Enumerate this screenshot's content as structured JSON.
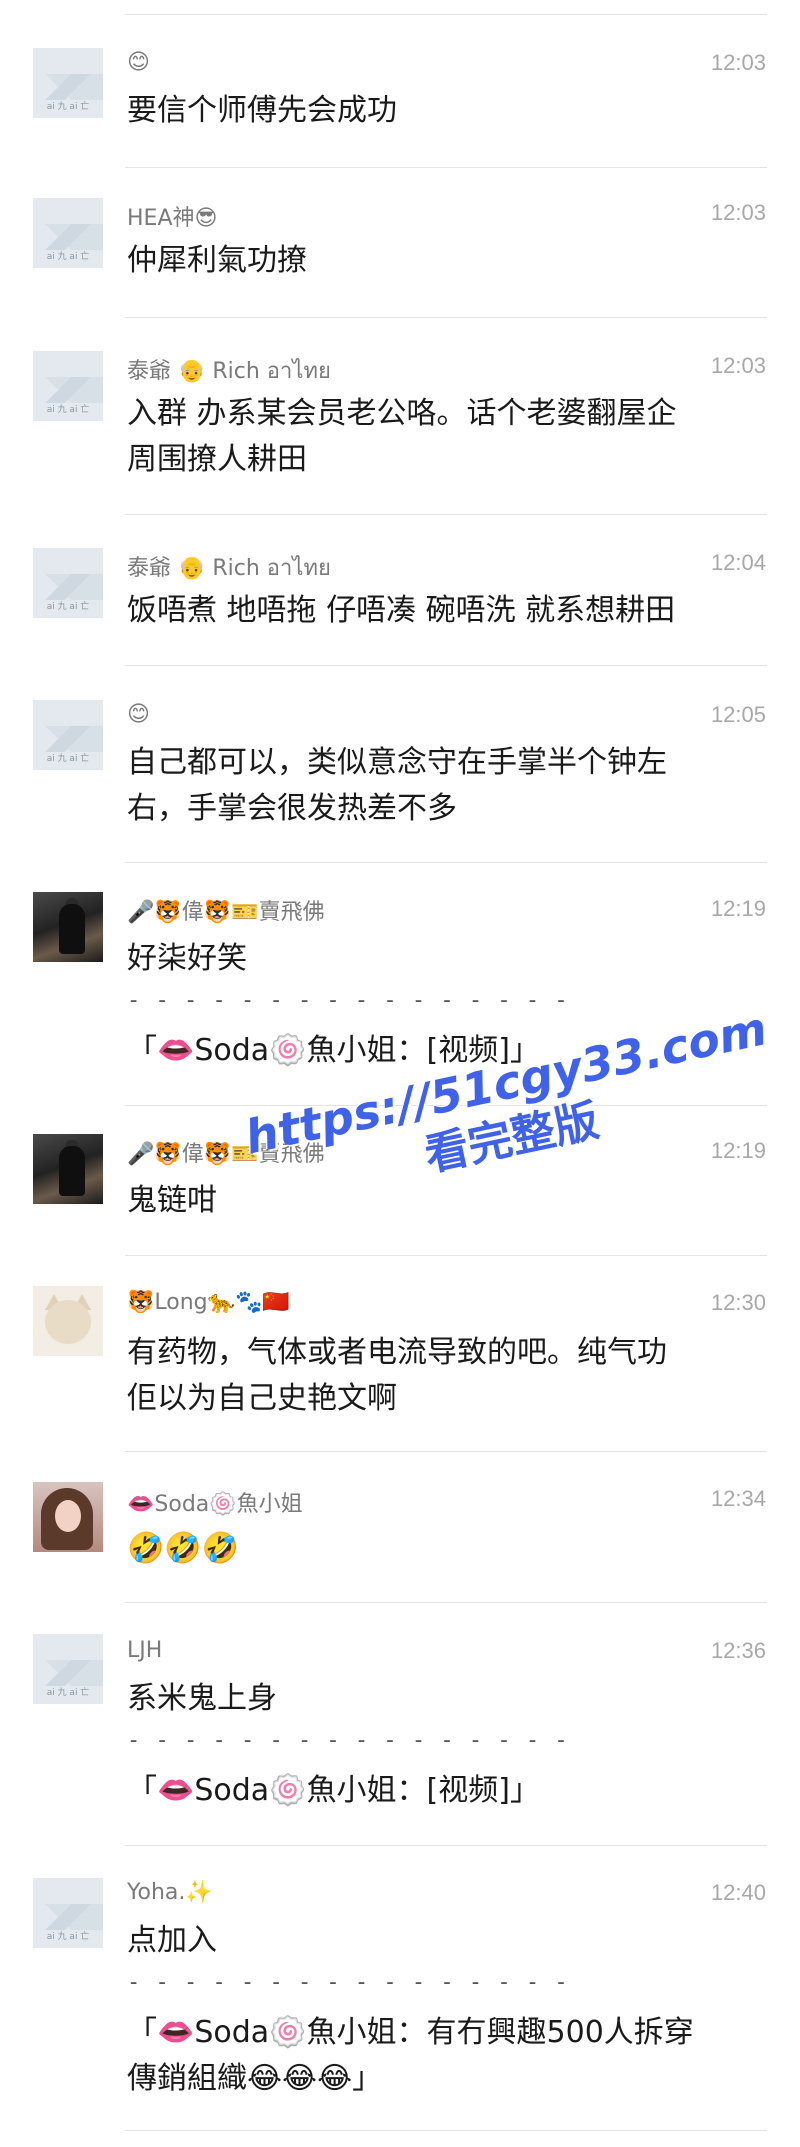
{
  "messages": [
    {
      "name": "😊",
      "time": "12:03",
      "text": "要信个师傅先会成功",
      "avatar": "default",
      "avatar_caption": "ai 九 ai 亡"
    },
    {
      "name": "HEA神😎",
      "time": "12:03",
      "text": "仲犀利氣功撩",
      "avatar": "default",
      "avatar_caption": "ai 九 ai 亡"
    },
    {
      "name": "泰爺 👴 Rich อาไทย",
      "time": "12:03",
      "text": "入群 办系某会员老公咯。话个老婆翻屋企\n周围撩人耕田",
      "avatar": "default",
      "avatar_caption": "ai 九 ai 亡"
    },
    {
      "name": "泰爺 👴 Rich อาไทย",
      "time": "12:04",
      "text": "饭唔煮 地唔拖 仔唔凑 碗唔洗 就系想耕田",
      "avatar": "default",
      "avatar_caption": "ai 九 ai 亡"
    },
    {
      "name": "😊",
      "time": "12:05",
      "text": "自己都可以，类似意念守在手掌半个钟左\n右，手掌会很发热差不多",
      "avatar": "default",
      "avatar_caption": "ai 九 ai 亡"
    },
    {
      "name": "🎤🐯偉🐯🎫賣飛佛",
      "time": "12:19",
      "text": "好柒好笑",
      "avatar": "photo-studio",
      "dashes": "- - - - - - - - - - - - - - - -",
      "quote": "「👄Soda🍥魚小姐：[视频]」"
    },
    {
      "name": "🎤🐯偉🐯🎫賣飛佛",
      "time": "12:19",
      "text": "鬼链咁",
      "avatar": "photo-studio"
    },
    {
      "name": "🐯Long🐆🐾🇨🇳",
      "time": "12:30",
      "text": "有药物，气体或者电流导致的吧。纯气功\n佢以为自己史艳文啊",
      "avatar": "photo-cat"
    },
    {
      "name": "👄Soda🍥魚小姐",
      "time": "12:34",
      "text": "🤣🤣🤣",
      "avatar": "photo-girl"
    },
    {
      "name": "LJH",
      "time": "12:36",
      "text": "系米鬼上身",
      "avatar": "default",
      "avatar_caption": "ai 九 ai 亡",
      "dashes": "- - - - - - - - - - - - - - - -",
      "quote": "「👄Soda🍥魚小姐：[视频]」"
    },
    {
      "name": "Yoha.✨",
      "time": "12:40",
      "text": "点加入",
      "avatar": "default",
      "avatar_caption": "ai 九 ai 亡",
      "dashes": "- - - - - - - - - - - - - - - -",
      "quote": "「👄Soda🍥魚小姐：有冇興趣500人拆穿\n傳銷組織😂😂😂」"
    }
  ],
  "watermark": {
    "line1": "https://51cgy33.com",
    "line2": "看完整版"
  },
  "colors": {
    "watermark": "#3f62e8",
    "name": "#7a7a7a",
    "time": "#a8a8a8",
    "divider": "#e4e4e4"
  }
}
